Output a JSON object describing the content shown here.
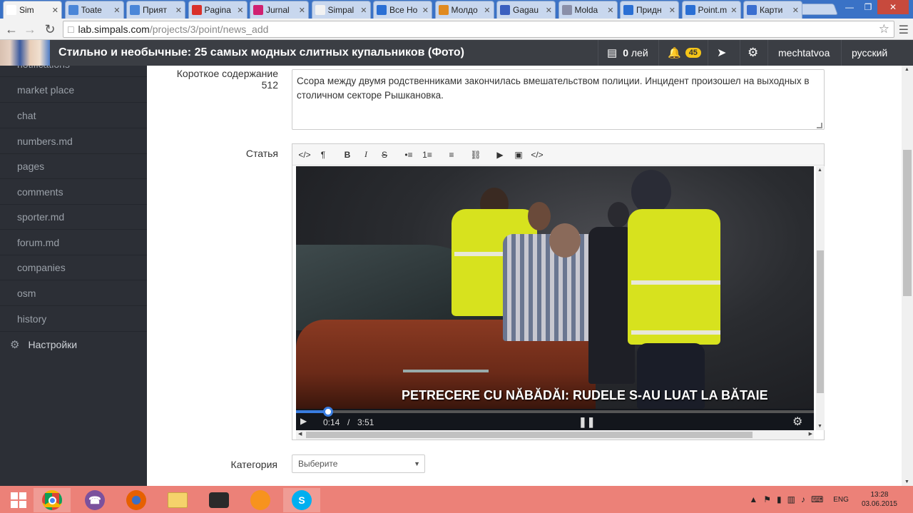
{
  "browser": {
    "tabs": [
      {
        "label": "Sim",
        "color": "#ffffff",
        "active": true
      },
      {
        "label": "Toate",
        "color": "#4a86d8"
      },
      {
        "label": "Прият",
        "color": "#4a86d8"
      },
      {
        "label": "Pagina",
        "color": "#d9302a"
      },
      {
        "label": "Jurnal",
        "color": "#d02070"
      },
      {
        "label": "Simpal",
        "color": "#f2f2f2"
      },
      {
        "label": "Все Но",
        "color": "#2a6fd4"
      },
      {
        "label": "Молдо",
        "color": "#e08a20"
      },
      {
        "label": "Gagau",
        "color": "#3a5fbf"
      },
      {
        "label": "Molda",
        "color": "#8a8fa8"
      },
      {
        "label": "Придн",
        "color": "#2a6fd4"
      },
      {
        "label": "Point.m",
        "color": "#2a6fd4"
      },
      {
        "label": "Карти",
        "color": "#3a6fd0"
      }
    ],
    "url_host": "lab.simpals.com",
    "url_path": "/projects/3/point/news_add"
  },
  "header": {
    "article_title": "Стильно и необычные: 25 самых модных слитных купальников (Фото)",
    "wallet": "0",
    "wallet_unit": "лей",
    "notifications": "45",
    "username": "mechtatvoa",
    "language": "русский"
  },
  "sidebar": {
    "items": [
      {
        "label": "notifications"
      },
      {
        "label": "market place"
      },
      {
        "label": "chat"
      },
      {
        "label": "numbers.md"
      },
      {
        "label": "pages"
      },
      {
        "label": "comments"
      },
      {
        "label": "sporter.md"
      },
      {
        "label": "forum.md"
      },
      {
        "label": "companies"
      },
      {
        "label": "osm"
      },
      {
        "label": "history"
      }
    ],
    "settings_label": "Настройки"
  },
  "form": {
    "summary_label": "Короткое содержание",
    "summary_count": "512",
    "summary_text": "Ссора между двумя родственниками закончилась вмешательством полиции. Инцидент произошел на выходных в столичном секторе Рышкановка.",
    "article_label": "Статья",
    "category_label": "Категория",
    "category_value": "Выберите"
  },
  "editor": {
    "tools": [
      "</>",
      "¶",
      "B",
      "I",
      "S",
      "•≡",
      "1≡",
      "≡",
      "⛓",
      "▶",
      "▣",
      "</>"
    ],
    "video_caption": "PETRECERE CU NĂBĂDĂI: RUDELE S-AU LUAT LA BĂTAIE",
    "video_time": "0:14",
    "video_duration": "3:51",
    "progress_fraction": 0.062
  },
  "taskbar": {
    "time": "13:28",
    "date": "03.06.2015",
    "lang": "ENG"
  }
}
